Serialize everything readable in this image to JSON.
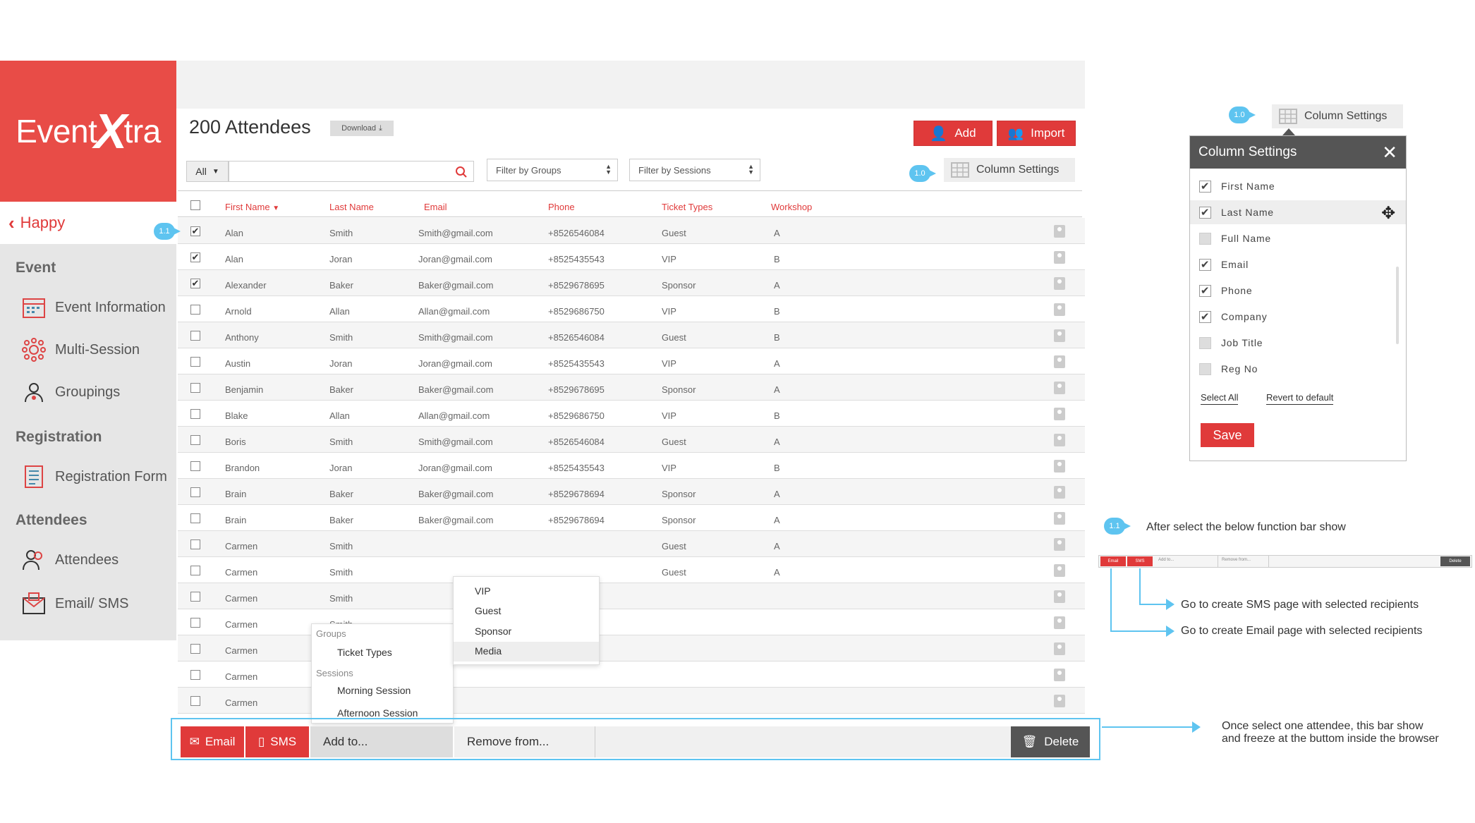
{
  "app": {
    "logo_left": "Event",
    "logo_x": "X",
    "logo_right": "tra",
    "nav_back": "Happy"
  },
  "sidebar": {
    "sections": [
      "Event",
      "Registration",
      "Attendees"
    ],
    "items": [
      "Event Information",
      "Multi-Session",
      "Groupings",
      "Registration Form",
      "Attendees",
      "Email/ SMS"
    ]
  },
  "header": {
    "title": "200 Attendees",
    "download": "Download",
    "add": "Add",
    "import": "Import"
  },
  "filters": {
    "scope": "All",
    "groups": "Filter by Groups",
    "sessions": "Filter by Sessions",
    "column_settings": "Column Settings"
  },
  "badges": {
    "one": "1.0",
    "two": "1.1"
  },
  "table": {
    "columns": [
      "First Name",
      "Last Name",
      "Email",
      "Phone",
      "Ticket Types",
      "Workshop"
    ],
    "rows": [
      {
        "checked": true,
        "first": "Alan",
        "last": "Smith",
        "email": "Smith@gmail.com",
        "phone": "+8526546084",
        "ticket": "Guest",
        "ws": "A"
      },
      {
        "checked": true,
        "first": "Alan",
        "last": "Joran",
        "email": "Joran@gmail.com",
        "phone": "+8525435543",
        "ticket": "VIP",
        "ws": "B"
      },
      {
        "checked": true,
        "first": "Alexander",
        "last": "Baker",
        "email": "Baker@gmail.com",
        "phone": "+8529678695",
        "ticket": "Sponsor",
        "ws": "A"
      },
      {
        "checked": false,
        "first": "Arnold",
        "last": "Allan",
        "email": "Allan@gmail.com",
        "phone": "+8529686750",
        "ticket": "VIP",
        "ws": "B"
      },
      {
        "checked": false,
        "first": "Anthony",
        "last": "Smith",
        "email": "Smith@gmail.com",
        "phone": "+8526546084",
        "ticket": "Guest",
        "ws": "B"
      },
      {
        "checked": false,
        "first": "Austin",
        "last": "Joran",
        "email": "Joran@gmail.com",
        "phone": "+8525435543",
        "ticket": "VIP",
        "ws": "A"
      },
      {
        "checked": false,
        "first": "Benjamin",
        "last": "Baker",
        "email": "Baker@gmail.com",
        "phone": "+8529678695",
        "ticket": "Sponsor",
        "ws": "A"
      },
      {
        "checked": false,
        "first": "Blake",
        "last": "Allan",
        "email": "Allan@gmail.com",
        "phone": "+8529686750",
        "ticket": "VIP",
        "ws": "B"
      },
      {
        "checked": false,
        "first": "Boris",
        "last": "Smith",
        "email": "Smith@gmail.com",
        "phone": "+8526546084",
        "ticket": "Guest",
        "ws": "A"
      },
      {
        "checked": false,
        "first": "Brandon",
        "last": "Joran",
        "email": "Joran@gmail.com",
        "phone": "+8525435543",
        "ticket": "VIP",
        "ws": "B"
      },
      {
        "checked": false,
        "first": "Brain",
        "last": "Baker",
        "email": "Baker@gmail.com",
        "phone": "+8529678694",
        "ticket": "Sponsor",
        "ws": "A"
      },
      {
        "checked": false,
        "first": "Brain",
        "last": "Baker",
        "email": "Baker@gmail.com",
        "phone": "+8529678694",
        "ticket": "Sponsor",
        "ws": "A"
      },
      {
        "checked": false,
        "first": "Carmen",
        "last": "Smith",
        "email": "",
        "phone": "",
        "ticket": "Guest",
        "ws": "A"
      },
      {
        "checked": false,
        "first": "Carmen",
        "last": "Smith",
        "email": "",
        "phone": "",
        "ticket": "Guest",
        "ws": "A"
      },
      {
        "checked": false,
        "first": "Carmen",
        "last": "Smith",
        "email": "",
        "phone": "",
        "ticket": "",
        "ws": ""
      },
      {
        "checked": false,
        "first": "Carmen",
        "last": "Smith",
        "email": "",
        "phone": "",
        "ticket": "",
        "ws": ""
      },
      {
        "checked": false,
        "first": "Carmen",
        "last": "",
        "email": "",
        "phone": "",
        "ticket": "",
        "ws": ""
      },
      {
        "checked": false,
        "first": "Carmen",
        "last": "",
        "email": "",
        "phone": "",
        "ticket": "",
        "ws": ""
      },
      {
        "checked": false,
        "first": "Carmen",
        "last": "",
        "email": "",
        "phone": "",
        "ticket": "",
        "ws": ""
      }
    ]
  },
  "add_menu": {
    "groups_header": "Groups",
    "ticket_types": "Ticket Types",
    "sessions_header": "Sessions",
    "morning": "Morning Session",
    "afternoon": "Afternoon Session"
  },
  "ticket_menu": [
    "VIP",
    "Guest",
    "Sponsor",
    "Media"
  ],
  "bottom_bar": {
    "email": "Email",
    "sms": "SMS",
    "add": "Add to...",
    "remove": "Remove from...",
    "delete": "Delete"
  },
  "column_panel": {
    "title": "Column Settings",
    "items": [
      {
        "label": "First Name",
        "checked": true
      },
      {
        "label": "Last Name",
        "checked": true
      },
      {
        "label": "Full Name",
        "checked": false
      },
      {
        "label": "Email",
        "checked": true
      },
      {
        "label": "Phone",
        "checked": true
      },
      {
        "label": "Company",
        "checked": true
      },
      {
        "label": "Job Title",
        "checked": false
      },
      {
        "label": "Reg No",
        "checked": false
      }
    ],
    "select_all": "Select All",
    "revert": "Revert to default",
    "save": "Save"
  },
  "notes": {
    "after_select": "After select the below function bar show",
    "sms": "Go to create SMS page with selected recipients",
    "email": "Go to create Email page with selected recipients",
    "freeze1": "Once select one attendee, this bar show",
    "freeze2": "and freeze at the buttom inside the browser"
  },
  "mini_bar": {
    "email": "Email",
    "sms": "SMS",
    "add": "Add to...",
    "remove": "Remove from...",
    "delete": "Delete"
  },
  "colors": {
    "accent": "#e03a3a",
    "brand": "#e84c47",
    "info": "#5ec4f0"
  }
}
